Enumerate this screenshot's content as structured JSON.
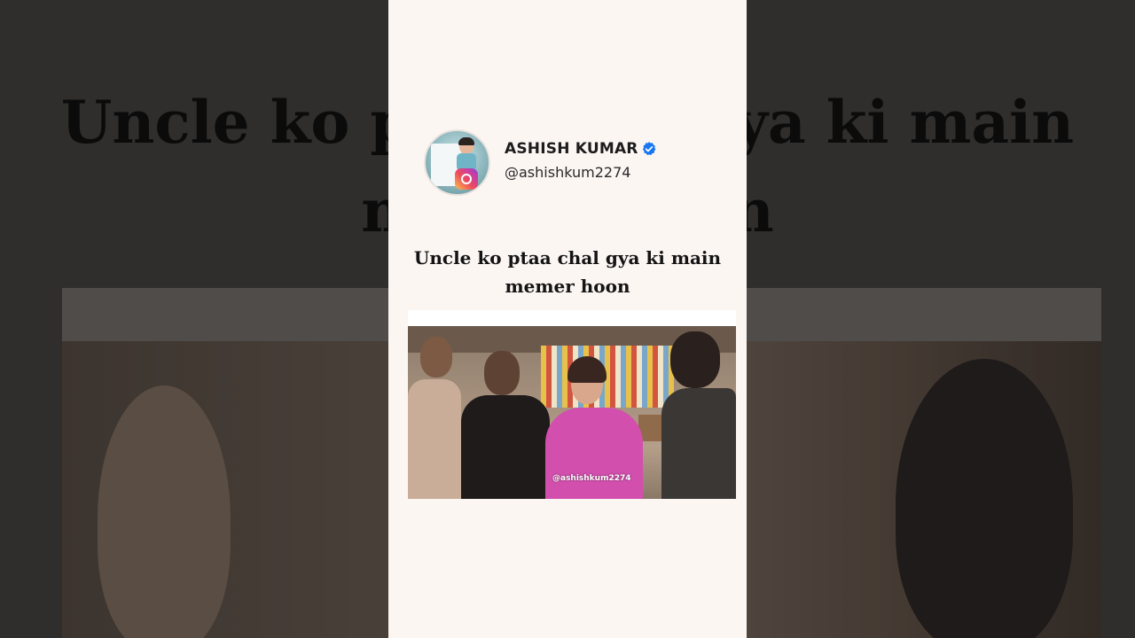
{
  "post": {
    "author_name": "ASHISH KUMAR",
    "author_handle": "@ashishkum2274",
    "caption_line1": "Uncle ko ptaa chal gya ki main",
    "caption_line2": "memer hoon",
    "watermark": "@ashishkum2274"
  },
  "background": {
    "line1": "Uncle ko ptaa chal gya ki main",
    "line2": "memer hoon"
  },
  "icons": {
    "avatar": "avatar-icon",
    "verified": "verified-badge-icon",
    "instagram": "instagram-icon"
  },
  "colors": {
    "panel": "#fcf6f3",
    "verified": "#1877f2",
    "text": "#1c1c1c"
  }
}
